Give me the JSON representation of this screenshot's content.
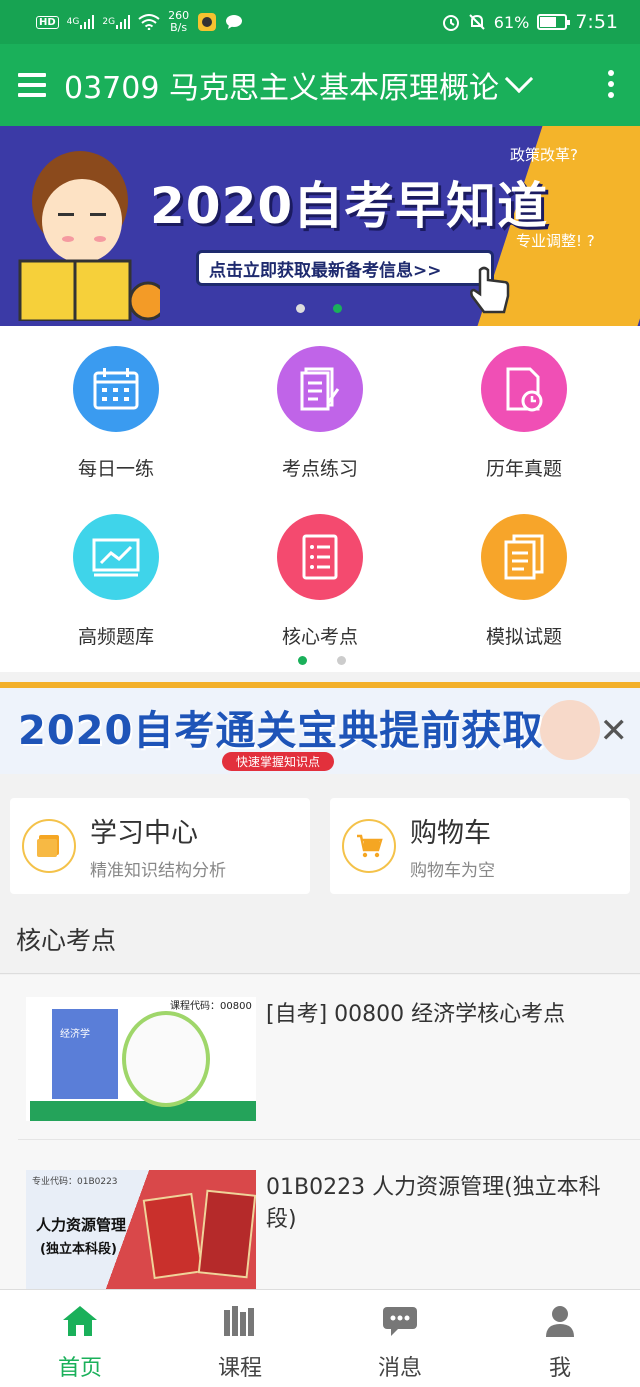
{
  "status_bar": {
    "hd": "HD",
    "signal1": "4G",
    "signal2": "2G",
    "speed_value": "260",
    "speed_unit": "B/s",
    "battery": "61%",
    "battery_level": 0.61,
    "time": "7:51"
  },
  "app_bar": {
    "title": "03709 马克思主义基本原理概论"
  },
  "banner": {
    "title": "2020自考早知道",
    "cta": "点击立即获取最新备考信息>>",
    "question1": "政策改革?",
    "question2": "专业调整! ?"
  },
  "grid": {
    "items": [
      {
        "label": "每日一练",
        "color": "#3a9bf0"
      },
      {
        "label": "考点练习",
        "color": "#c064e8"
      },
      {
        "label": "历年真题",
        "color": "#f04fb5"
      },
      {
        "label": "高频题库",
        "color": "#3fd4ea"
      },
      {
        "label": "核心考点",
        "color": "#f44a6f"
      },
      {
        "label": "模拟试题",
        "color": "#f7a52a"
      }
    ]
  },
  "ad2": {
    "title": "2020自考通关宝典提前获取",
    "subtitle": "快速掌握知识点"
  },
  "cards": [
    {
      "title": "学习中心",
      "subtitle": "精准知识结构分析"
    },
    {
      "title": "购物车",
      "subtitle": "购物车为空"
    }
  ],
  "section": {
    "title": "核心考点",
    "items": [
      {
        "title": "[自考] 00800 经济学核心考点",
        "thumb_code": "课程代码：00800",
        "thumb_book": "经济学"
      },
      {
        "title": "01B0223 人力资源管理(独立本科段)",
        "thumb_code": "专业代码：01B0223",
        "thumb_book": "人力资源管理",
        "thumb_book2": "(独立本科段)"
      }
    ]
  },
  "bottom_nav": {
    "items": [
      {
        "label": "首页"
      },
      {
        "label": "课程"
      },
      {
        "label": "消息"
      },
      {
        "label": "我"
      }
    ]
  },
  "colors": {
    "brand_green": "#1ab05a",
    "status_green": "#17a352"
  }
}
